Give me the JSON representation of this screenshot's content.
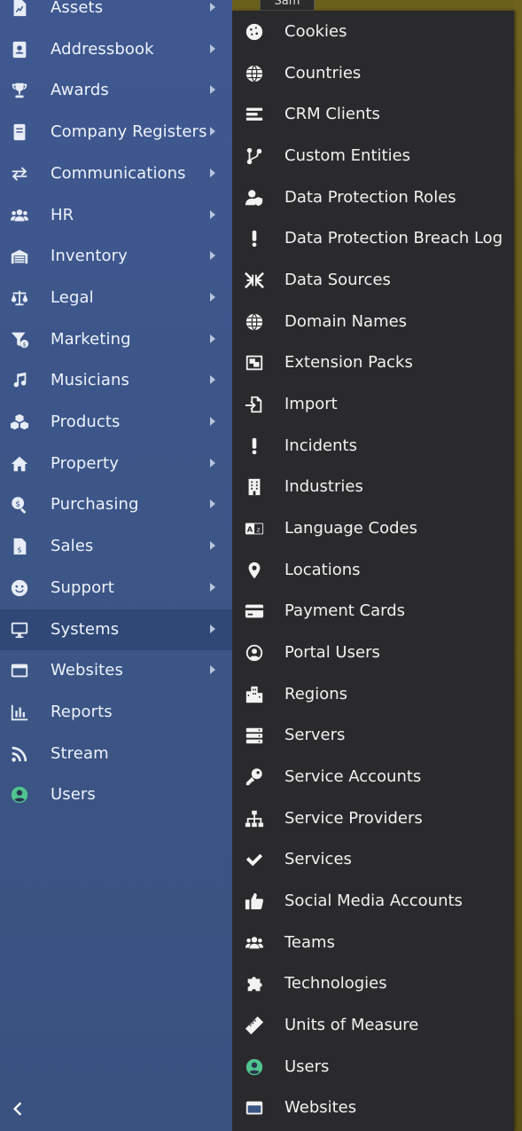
{
  "background": {
    "tab_label": "Sam"
  },
  "sidebar": {
    "items": [
      {
        "label": "Assets",
        "icon": "file-chart-icon",
        "arrow": true
      },
      {
        "label": "Addressbook",
        "icon": "address-book-icon",
        "arrow": true
      },
      {
        "label": "Awards",
        "icon": "trophy-icon",
        "arrow": true
      },
      {
        "label": "Company Registers",
        "icon": "book-icon",
        "arrow": true
      },
      {
        "label": "Communications",
        "icon": "exchange-arrows-icon",
        "arrow": true
      },
      {
        "label": "HR",
        "icon": "users-icon",
        "arrow": true
      },
      {
        "label": "Inventory",
        "icon": "warehouse-icon",
        "arrow": true
      },
      {
        "label": "Legal",
        "icon": "balance-scale-icon",
        "arrow": true
      },
      {
        "label": "Marketing",
        "icon": "funnel-dollar-icon",
        "arrow": true
      },
      {
        "label": "Musicians",
        "icon": "music-note-icon",
        "arrow": true
      },
      {
        "label": "Products",
        "icon": "cubes-icon",
        "arrow": true
      },
      {
        "label": "Property",
        "icon": "home-icon",
        "arrow": true
      },
      {
        "label": "Purchasing",
        "icon": "search-dollar-icon",
        "arrow": true
      },
      {
        "label": "Sales",
        "icon": "file-invoice-dollar-icon",
        "arrow": true
      },
      {
        "label": "Support",
        "icon": "smile-icon",
        "arrow": true
      },
      {
        "label": "Systems",
        "icon": "desktop-icon",
        "arrow": true,
        "active": true
      },
      {
        "label": "Websites",
        "icon": "window-icon",
        "arrow": true
      },
      {
        "label": "Reports",
        "icon": "bar-chart-icon",
        "arrow": false
      },
      {
        "label": "Stream",
        "icon": "rss-icon",
        "arrow": false
      },
      {
        "label": "Users",
        "icon": "user-circle-icon",
        "arrow": false,
        "accent": "#4fc48e"
      }
    ],
    "collapse_icon": "chevron-left-icon"
  },
  "submenu": {
    "items": [
      {
        "label": "Cookies",
        "icon": "cookie-icon"
      },
      {
        "label": "Countries",
        "icon": "globe-icon"
      },
      {
        "label": "CRM Clients",
        "icon": "list-bars-icon"
      },
      {
        "label": "Custom Entities",
        "icon": "code-branch-icon"
      },
      {
        "label": "Data Protection Roles",
        "icon": "user-shield-icon"
      },
      {
        "label": "Data Protection Breach Log",
        "icon": "exclamation-icon"
      },
      {
        "label": "Data Sources",
        "icon": "compress-arrows-icon"
      },
      {
        "label": "Domain Names",
        "icon": "globe-icon"
      },
      {
        "label": "Extension Packs",
        "icon": "object-group-icon"
      },
      {
        "label": "Import",
        "icon": "file-import-icon"
      },
      {
        "label": "Incidents",
        "icon": "exclamation-icon"
      },
      {
        "label": "Industries",
        "icon": "building-icon"
      },
      {
        "label": "Language Codes",
        "icon": "language-icon"
      },
      {
        "label": "Locations",
        "icon": "map-marker-icon"
      },
      {
        "label": "Payment Cards",
        "icon": "credit-card-icon"
      },
      {
        "label": "Portal Users",
        "icon": "user-circle-outline-icon"
      },
      {
        "label": "Regions",
        "icon": "city-icon"
      },
      {
        "label": "Servers",
        "icon": "server-icon"
      },
      {
        "label": "Service Accounts",
        "icon": "key-icon"
      },
      {
        "label": "Service Providers",
        "icon": "sitemap-icon"
      },
      {
        "label": "Services",
        "icon": "check-icon"
      },
      {
        "label": "Social Media Accounts",
        "icon": "thumbs-up-icon"
      },
      {
        "label": "Teams",
        "icon": "users-icon"
      },
      {
        "label": "Technologies",
        "icon": "puzzle-piece-icon"
      },
      {
        "label": "Units of Measure",
        "icon": "ruler-icon"
      },
      {
        "label": "Users",
        "icon": "user-circle-icon",
        "accent": "#4fc48e"
      },
      {
        "label": "Websites",
        "icon": "window-icon"
      }
    ]
  }
}
